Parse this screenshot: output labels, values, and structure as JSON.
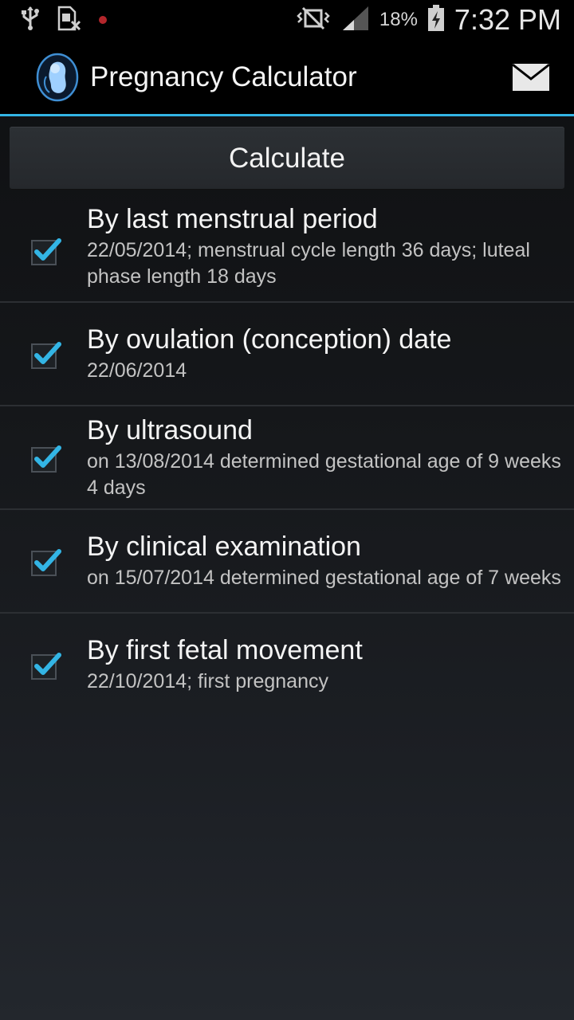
{
  "status_bar": {
    "battery_percent": "18%",
    "time": "7:32 PM",
    "icons": [
      "usb-icon",
      "sim-missing-icon",
      "recording-dot-icon",
      "vibrate-icon",
      "signal-icon",
      "battery-charging-icon"
    ]
  },
  "action_bar": {
    "title": "Pregnancy Calculator",
    "icons": [
      "fetus-app-icon",
      "mail-icon"
    ]
  },
  "calculate_label": "Calculate",
  "methods": [
    {
      "title": "By last menstrual period",
      "detail": "22/05/2014; menstrual cycle length 36 days; luteal phase length 18 days",
      "checked": true
    },
    {
      "title": "By ovulation (conception) date",
      "detail": "22/06/2014",
      "checked": true
    },
    {
      "title": "By ultrasound",
      "detail": "on 13/08/2014 determined gestational age of 9 weeks 4 days",
      "checked": true
    },
    {
      "title": "By clinical examination",
      "detail": "on 15/07/2014 determined gestational age of 7 weeks",
      "checked": true
    },
    {
      "title": "By first fetal movement",
      "detail": "22/10/2014; first pregnancy",
      "checked": true
    }
  ],
  "colors": {
    "accent": "#33b5e5",
    "background": "#15171a",
    "checkmark": "#33b5e5"
  }
}
